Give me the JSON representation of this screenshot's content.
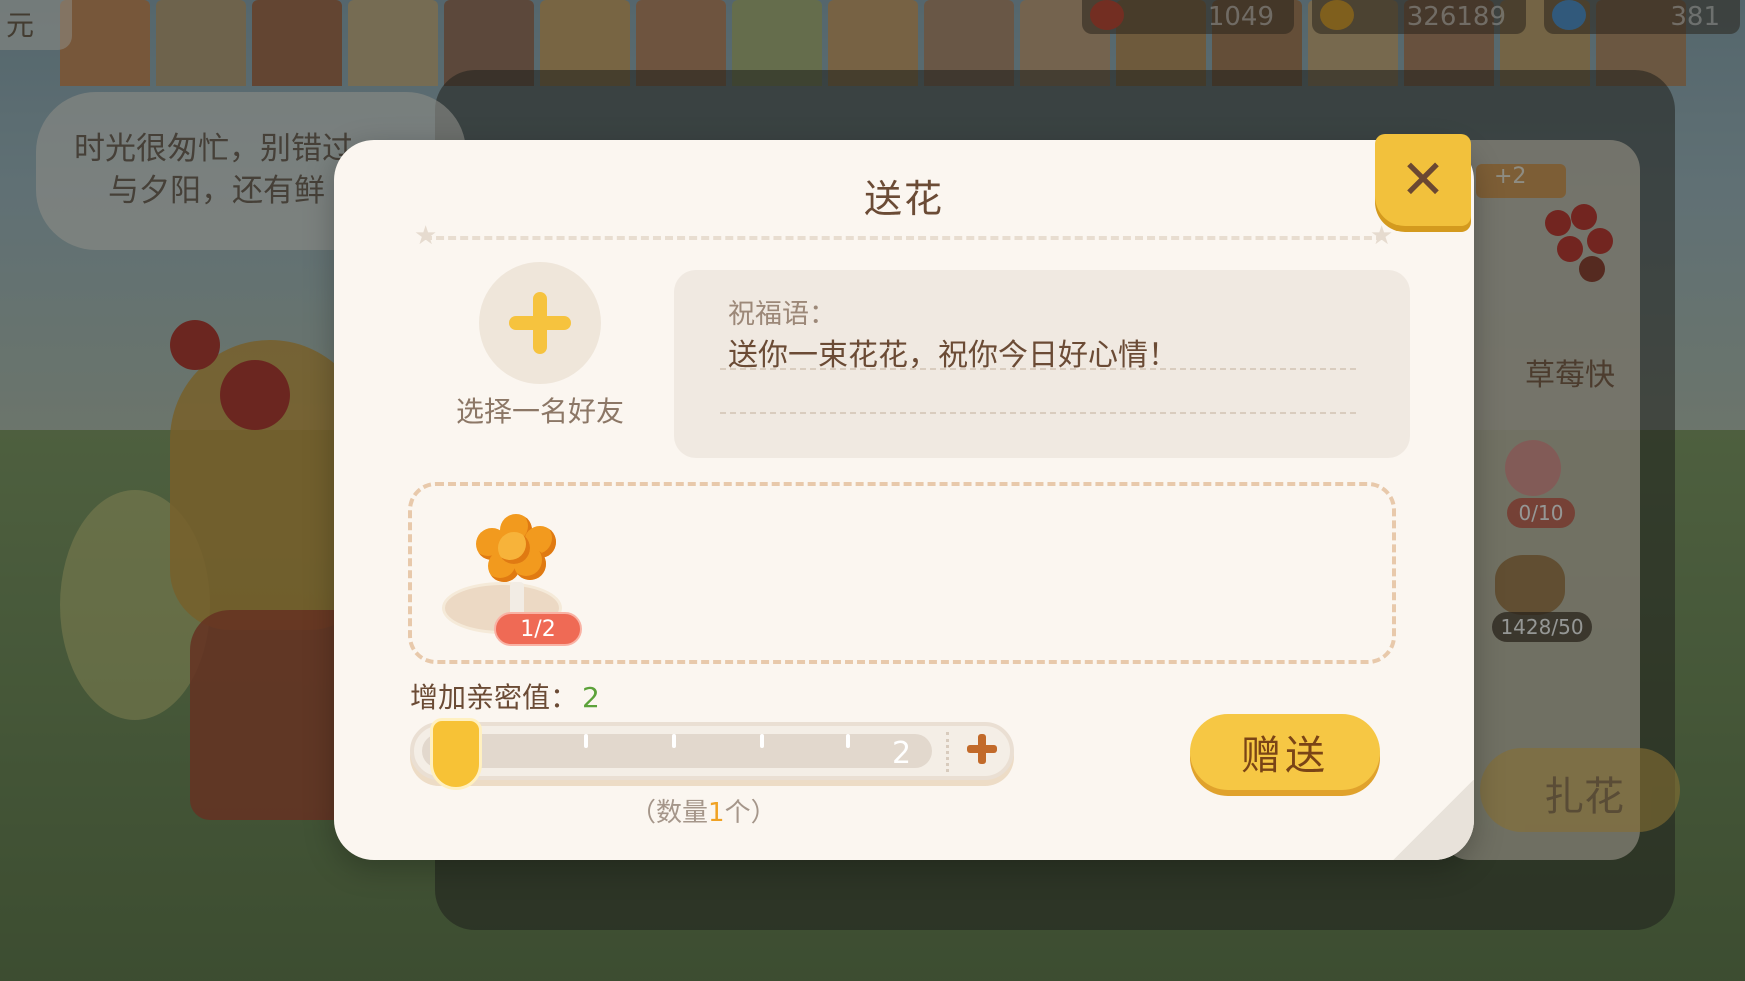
{
  "corner": {
    "text": "元"
  },
  "resources": [
    {
      "name": "energy",
      "value": "1049",
      "icon": "heart-plus-icon",
      "color": "#d94a3a"
    },
    {
      "name": "coins",
      "value": "326189",
      "icon": "coin-icon",
      "color": "#e7a92a"
    },
    {
      "name": "gems",
      "value": "381",
      "icon": "diamond-plus-icon",
      "color": "#5aa4e0"
    }
  ],
  "speech": {
    "line1": "时光很匆忙，别错过",
    "line2": "与夕阳，还有鲜"
  },
  "side_panel": {
    "badge": "+2",
    "item_label": "草莓快",
    "chips": [
      "0/10",
      "1428/50"
    ],
    "button_label": "扎花"
  },
  "dialog": {
    "title": "送花",
    "friend": {
      "label": "选择一名好友",
      "icon": "plus-icon"
    },
    "blessing": {
      "label": "祝福语：",
      "text": "送你一束花花，祝你今日好心情！"
    },
    "flower": {
      "name": "orange-flower-bouquet",
      "count": "1/2"
    },
    "intimacy": {
      "label": "增加亲密值：",
      "value": "2"
    },
    "slider": {
      "value_display": "2",
      "level": 0.1
    },
    "quantity_caption": {
      "prefix": "（数量",
      "number": "1",
      "suffix": "个）"
    },
    "send_label": "赠送",
    "close_icon": "close-icon"
  },
  "colors": {
    "accent": "#f6c744",
    "title": "#6b4b35",
    "intimacy": "#5ca23a",
    "badge": "#ef6a55"
  }
}
